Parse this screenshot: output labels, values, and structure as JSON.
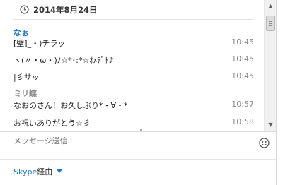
{
  "chat": {
    "date": "2014年8月24日",
    "groups": [
      {
        "sender": "なぉ",
        "messages": [
          {
            "text": "[壁]_・)チラッ",
            "time": "10:45"
          },
          {
            "text": "ヽ(〃・ω・)ﾉ☆*･:*☆ｵﾒﾃﾞﾄ♪",
            "time": "10:45"
          },
          {
            "text": "|彡サッ",
            "time": "10:45"
          }
        ]
      },
      {
        "sender": "ミリ蝶",
        "messages": [
          {
            "text": "なおのさん！お久しぶり*・∀・*",
            "time": "10:57"
          },
          {
            "text": "お祝いありがとう☆彡",
            "time": "10:58"
          }
        ]
      }
    ]
  },
  "input": {
    "placeholder": "メッセージ送信"
  },
  "footer": {
    "via_brand": "Skype",
    "via_suffix": "経由"
  },
  "icons": {
    "date": "clock-icon",
    "emoticon": "smiley-icon",
    "dropdown": "chevron-down-icon"
  },
  "colors": {
    "accent": "#1a79c8",
    "muted": "#8a8a8a"
  }
}
